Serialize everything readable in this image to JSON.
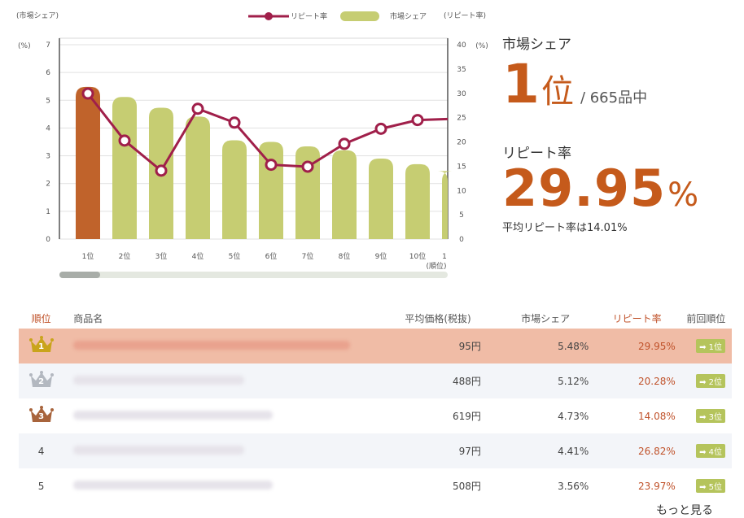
{
  "chart_data": {
    "type": "bar+line",
    "categories": [
      "1位",
      "2位",
      "3位",
      "4位",
      "5位",
      "6位",
      "7位",
      "8位",
      "9位",
      "10位",
      "1"
    ],
    "x_unit": "(順位)",
    "series": [
      {
        "name": "市場シェア",
        "type": "bar",
        "axis": "left",
        "values": [
          5.48,
          5.12,
          4.73,
          4.41,
          3.56,
          3.5,
          3.34,
          3.2,
          2.9,
          2.7,
          2.45
        ]
      },
      {
        "name": "リピート率",
        "type": "line",
        "axis": "right",
        "values": [
          29.95,
          20.28,
          14.08,
          26.82,
          23.97,
          15.3,
          14.9,
          19.6,
          22.7,
          24.5,
          24.7
        ]
      }
    ],
    "left_axis": {
      "label": "(市場シェア)",
      "unit": "(%)",
      "ylim": [
        0,
        7
      ],
      "ticks": [
        0,
        1,
        2,
        3,
        4,
        5,
        6,
        7
      ]
    },
    "right_axis": {
      "label": "(リピート率)",
      "unit": "(%)",
      "ylim": [
        0,
        40
      ],
      "ticks": [
        0,
        5,
        10,
        15,
        20,
        25,
        30,
        35,
        40
      ]
    },
    "legend": {
      "placement": "top-center",
      "items": [
        "リピート率",
        "市場シェア"
      ]
    },
    "grid": true,
    "colors": {
      "bar": "#c6cd72",
      "highlight_bar": "#c0632b",
      "line": "#a01f4a"
    }
  },
  "stats": {
    "share_title": "市場シェア",
    "share_rank": "1",
    "share_rank_unit": "位",
    "share_of": "/ 665品中",
    "repeat_title": "リピート率",
    "repeat_value": "29.95",
    "repeat_unit": "%",
    "avg_note": "平均リピート率は14.01%"
  },
  "table": {
    "headers": {
      "rank": "順位",
      "name": "商品名",
      "price": "平均価格(税抜)",
      "share": "市場シェア",
      "repeat": "リピート率",
      "prev": "前回順位"
    },
    "rows": [
      {
        "rank": "1",
        "price": "95円",
        "share": "5.48%",
        "repeat": "29.95%",
        "prev": "➡ 1位"
      },
      {
        "rank": "2",
        "price": "488円",
        "share": "5.12%",
        "repeat": "20.28%",
        "prev": "➡ 2位"
      },
      {
        "rank": "3",
        "price": "619円",
        "share": "4.73%",
        "repeat": "14.08%",
        "prev": "➡ 3位"
      },
      {
        "rank": "4",
        "price": "97円",
        "share": "4.41%",
        "repeat": "26.82%",
        "prev": "➡ 4位"
      },
      {
        "rank": "5",
        "price": "508円",
        "share": "3.56%",
        "repeat": "23.97%",
        "prev": "➡ 5位"
      }
    ],
    "crown_colors": [
      "#c9a41c",
      "#b3b8c0",
      "#a8643c"
    ]
  },
  "more_link": "もっと見る"
}
